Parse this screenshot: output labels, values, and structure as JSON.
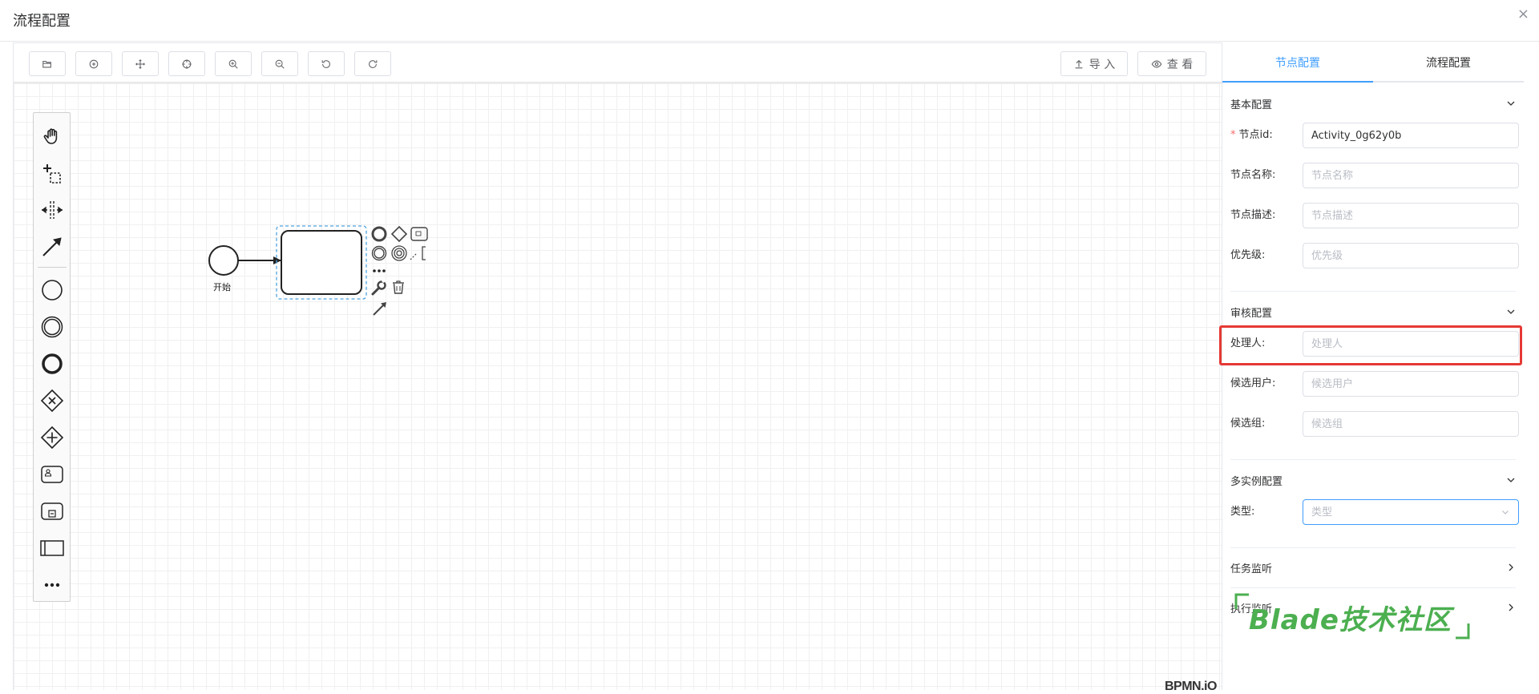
{
  "dialog": {
    "title": "流程配置",
    "close_glyph": "×"
  },
  "toolbar": {
    "icon_buttons": [
      "open-folder-icon",
      "add-circle-icon",
      "move-icon",
      "crosshair-icon",
      "zoom-in-icon",
      "zoom-out-icon",
      "undo-icon",
      "redo-icon"
    ],
    "import_label": "导 入",
    "view_label": "查 看"
  },
  "palette": {
    "tools": [
      "hand-tool-icon",
      "lasso-tool-icon",
      "space-tool-icon",
      "connect-tool-icon",
      "start-event-icon",
      "intermediate-event-icon",
      "end-event-icon",
      "exclusive-gateway-icon",
      "parallel-gateway-icon",
      "user-task-icon",
      "subprocess-icon",
      "pool-icon",
      "more-icon"
    ]
  },
  "diagram": {
    "start_label": "开始",
    "logo": "BPMN.iO"
  },
  "panel": {
    "tabs": [
      "节点配置",
      "流程配置"
    ],
    "active_tab": 0,
    "basic": {
      "title": "基本配置",
      "node_id_label": "节点id:",
      "node_id_value": "Activity_0g62y0b",
      "node_name_label": "节点名称:",
      "node_name_placeholder": "节点名称",
      "node_desc_label": "节点描述:",
      "node_desc_placeholder": "节点描述",
      "priority_label": "优先级:",
      "priority_placeholder": "优先级"
    },
    "approval": {
      "title": "审核配置",
      "assignee_label": "处理人:",
      "assignee_placeholder": "处理人",
      "candidate_users_label": "候选用户:",
      "candidate_users_placeholder": "候选用户",
      "candidate_groups_label": "候选组:",
      "candidate_groups_placeholder": "候选组"
    },
    "multi_instance": {
      "title": "多实例配置",
      "type_label": "类型:",
      "type_placeholder": "类型"
    },
    "task_listener": {
      "title": "任务监听"
    },
    "exec_listener": {
      "title": "执行监听"
    }
  },
  "watermark": {
    "text": "Blade技术社区"
  },
  "colors": {
    "accent": "#409eff",
    "highlight": "#e53935",
    "watermark": "#4caf50",
    "selection": "#4da3e0"
  }
}
